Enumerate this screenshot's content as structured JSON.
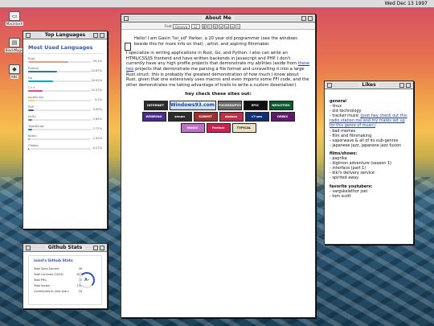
{
  "menubar": {
    "clock": "Wed Dec 13 1997"
  },
  "desktop": {
    "icons": [
      {
        "label": "Macintosh"
      },
      {
        "label": "BlackMagic"
      },
      {
        "label": "ANC"
      }
    ]
  },
  "about": {
    "title": "About Me",
    "toolbar": {
      "font": "Geneva",
      "size": "12"
    },
    "paragraphs": {
      "p1": "Hello! I am Gavin \"ioi_xd\" Parker, a 20 year old programmer (see the windows beside this for more info on that) , artist, and aspiring filmmaker.",
      "p2a": "I specialize in writing applications in Rust, Go, and Python. I also can write an HTML/CSS/JS frontend and have written backends in Javascript and PHP. I don't currently have any high profile projects that demonstrate my abilities (aside from ",
      "p2link": "these two",
      "p2b": " projects that demonstrate me parsing a file format and unravelling it into a large Rust struct; this is probably the greatest demonstration of how much I know about Rust, given that one extensively uses macros and even imports some FFI code, and the other demonstrates me taking advantage of traits to write a custom deserializer)."
    },
    "hey_heading": "hey check these sites out:",
    "badges": [
      {
        "text": "INTERNET ARCHIVE",
        "color": "#2b2b2b"
      },
      {
        "text": "Windows93.com",
        "color": "#ffffff"
      },
      {
        "text": "FUCKEDUPVISION",
        "color": "#6a6a6a"
      },
      {
        "text": "EPIC",
        "color": "#111111"
      },
      {
        "text": "NEOCITIES",
        "color": "#0a5c2e"
      },
      {
        "text": "WEBRING",
        "color": "#4a2a8a"
      },
      {
        "text": "xenon",
        "color": "#2c2c2c"
      },
      {
        "text": "SUBMIT",
        "color": "#a03030"
      },
      {
        "text": "dosbox",
        "color": "#c0304a"
      },
      {
        "text": "c7-pm",
        "color": "#103070"
      },
      {
        "text": "ORBIX",
        "color": "#601a6a"
      },
      {
        "text": "MAGIC",
        "color": "#c070c8"
      },
      {
        "text": "Perfect PlayGame",
        "color": "#d02050"
      },
      {
        "text": "TYPICAL TECH",
        "color": "#e8e0c0"
      }
    ]
  },
  "langs": {
    "title": "Top Languages",
    "heading": "Most Used Languages",
    "items": [
      {
        "name": "Rust",
        "pct": "29.2%",
        "value": 29.2,
        "color": "#dea584"
      },
      {
        "name": "Python",
        "pct": "20.87%",
        "value": 20.87,
        "color": "#3572a5"
      },
      {
        "name": "Go",
        "pct": "18.02%",
        "value": 18.02,
        "color": "#00add8"
      },
      {
        "name": "C++",
        "pct": "10.37%",
        "value": 10.37,
        "color": "#f34b7d"
      },
      {
        "name": "JavaScript",
        "pct": "5.2%",
        "value": 5.2,
        "color": "#f1e05a"
      },
      {
        "name": "PHP",
        "pct": "3.99%",
        "value": 3.99,
        "color": "#4f5d95"
      },
      {
        "name": "GLSL",
        "pct": "2.85%",
        "value": 2.85,
        "color": "#5686a5"
      },
      {
        "name": "TypeScript",
        "pct": "2.77%",
        "value": 2.77,
        "color": "#3178c6"
      },
      {
        "name": "Kotlin",
        "pct": "1.35%",
        "value": 1.35,
        "color": "#a97bff"
      },
      {
        "name": "CMake",
        "pct": "0.27%",
        "value": 0.27,
        "color": "#da3434"
      }
    ]
  },
  "github": {
    "title": "Github Stats",
    "card_title": "ioixd's Github Stats",
    "stats": [
      {
        "label": "Total Stars Earned:",
        "value": "36"
      },
      {
        "label": "Total Commits (2023):",
        "value": "822"
      },
      {
        "label": "Total PRs:",
        "value": "35"
      },
      {
        "label": "Total Issues:",
        "value": "136"
      },
      {
        "label": "Contributed to (last year):",
        "value": "16"
      }
    ],
    "grade": "A-"
  },
  "likes": {
    "title": "Likes",
    "general_heading": "general",
    "general": [
      "- linux",
      "- old technology",
      "- tracker music ",
      "- bad memes",
      "- film and filmmaking",
      "- vaporwave & all of its sub-genres",
      "- japanese jazz, japanese jazz fusion"
    ],
    "tracker_link": "(psst hey check out this radio station me and my mates set up for this genre of music)",
    "films_heading": "films/shows:",
    "films": [
      "- paprika",
      "- digimon adventure (season 1)",
      "- interface (part 1)",
      "- kiki's delivery service",
      "- spirited away"
    ],
    "youtubers_heading": "favorite youtubers:",
    "youtubers": [
      "- vargskelethor joel",
      "- tom scott"
    ]
  }
}
